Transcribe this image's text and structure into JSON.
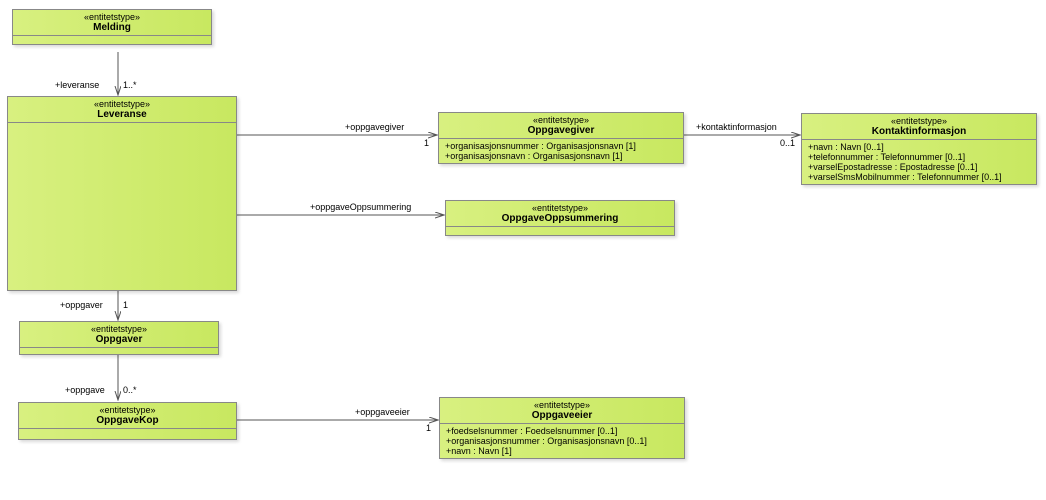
{
  "stereotype": "«entitetstype»",
  "entities": {
    "melding": {
      "name": "Melding"
    },
    "leveranse": {
      "name": "Leveranse"
    },
    "oppgavegiver": {
      "name": "Oppgavegiver",
      "attrs": [
        "+organisasjonsnummer : Organisasjonsnavn [1]",
        "+organisasjonsnavn : Organisasjonsnavn [1]"
      ]
    },
    "kontaktinfo": {
      "name": "Kontaktinformasjon",
      "attrs": [
        "+navn : Navn [0..1]",
        "+telefonnummer : Telefonnummer [0..1]",
        "+varselEpostadresse : Epostadresse [0..1]",
        "+varselSmsMobilnummer : Telefonnummer [0..1]"
      ]
    },
    "opsum": {
      "name": "OppgaveOppsummering"
    },
    "oppgaver": {
      "name": "Oppgaver"
    },
    "kop": {
      "name": "OppgaveKop"
    },
    "eier": {
      "name": "Oppgaveeier",
      "attrs": [
        "+foedselsnummer : Foedselsnummer [0..1]",
        "+organisasjonsnummer : Organisasjonsnavn [0..1]",
        "+navn : Navn [1]"
      ]
    }
  },
  "labels": {
    "leveranse": "+leveranse",
    "leveranse_m": "1..*",
    "oppgavegiver": "+oppgavegiver",
    "oppgavegiver_m": "1",
    "kontakt": "+kontaktinformasjon",
    "kontakt_m": "0..1",
    "opsum": "+oppgaveOppsummering",
    "oppgaver": "+oppgaver",
    "oppgaver_m": "1",
    "oppgave": "+oppgave",
    "oppgave_m": "0..*",
    "eier": "+oppgaveeier",
    "eier_m": "1"
  },
  "chart_data": {
    "type": "uml-class-diagram",
    "classes": [
      {
        "name": "Melding",
        "stereotype": "entitetstype"
      },
      {
        "name": "Leveranse",
        "stereotype": "entitetstype"
      },
      {
        "name": "Oppgavegiver",
        "stereotype": "entitetstype",
        "attributes": [
          {
            "name": "organisasjonsnummer",
            "type": "Organisasjonsnavn",
            "multiplicity": "1",
            "visibility": "+"
          },
          {
            "name": "organisasjonsnavn",
            "type": "Organisasjonsnavn",
            "multiplicity": "1",
            "visibility": "+"
          }
        ]
      },
      {
        "name": "Kontaktinformasjon",
        "stereotype": "entitetstype",
        "attributes": [
          {
            "name": "navn",
            "type": "Navn",
            "multiplicity": "0..1",
            "visibility": "+"
          },
          {
            "name": "telefonnummer",
            "type": "Telefonnummer",
            "multiplicity": "0..1",
            "visibility": "+"
          },
          {
            "name": "varselEpostadresse",
            "type": "Epostadresse",
            "multiplicity": "0..1",
            "visibility": "+"
          },
          {
            "name": "varselSmsMobilnummer",
            "type": "Telefonnummer",
            "multiplicity": "0..1",
            "visibility": "+"
          }
        ]
      },
      {
        "name": "OppgaveOppsummering",
        "stereotype": "entitetstype"
      },
      {
        "name": "Oppgaver",
        "stereotype": "entitetstype"
      },
      {
        "name": "OppgaveKop",
        "stereotype": "entitetstype"
      },
      {
        "name": "Oppgaveeier",
        "stereotype": "entitetstype",
        "attributes": [
          {
            "name": "foedselsnummer",
            "type": "Foedselsnummer",
            "multiplicity": "0..1",
            "visibility": "+"
          },
          {
            "name": "organisasjonsnummer",
            "type": "Organisasjonsnavn",
            "multiplicity": "0..1",
            "visibility": "+"
          },
          {
            "name": "navn",
            "type": "Navn",
            "multiplicity": "1",
            "visibility": "+"
          }
        ]
      }
    ],
    "associations": [
      {
        "from": "Melding",
        "to": "Leveranse",
        "role": "leveranse",
        "multiplicity": "1..*"
      },
      {
        "from": "Leveranse",
        "to": "Oppgavegiver",
        "role": "oppgavegiver",
        "multiplicity": "1"
      },
      {
        "from": "Oppgavegiver",
        "to": "Kontaktinformasjon",
        "role": "kontaktinformasjon",
        "multiplicity": "0..1"
      },
      {
        "from": "Leveranse",
        "to": "OppgaveOppsummering",
        "role": "oppgaveOppsummering"
      },
      {
        "from": "Leveranse",
        "to": "Oppgaver",
        "role": "oppgaver",
        "multiplicity": "1"
      },
      {
        "from": "Oppgaver",
        "to": "OppgaveKop",
        "role": "oppgave",
        "multiplicity": "0..*"
      },
      {
        "from": "OppgaveKop",
        "to": "Oppgaveeier",
        "role": "oppgaveeier",
        "multiplicity": "1"
      }
    ]
  }
}
